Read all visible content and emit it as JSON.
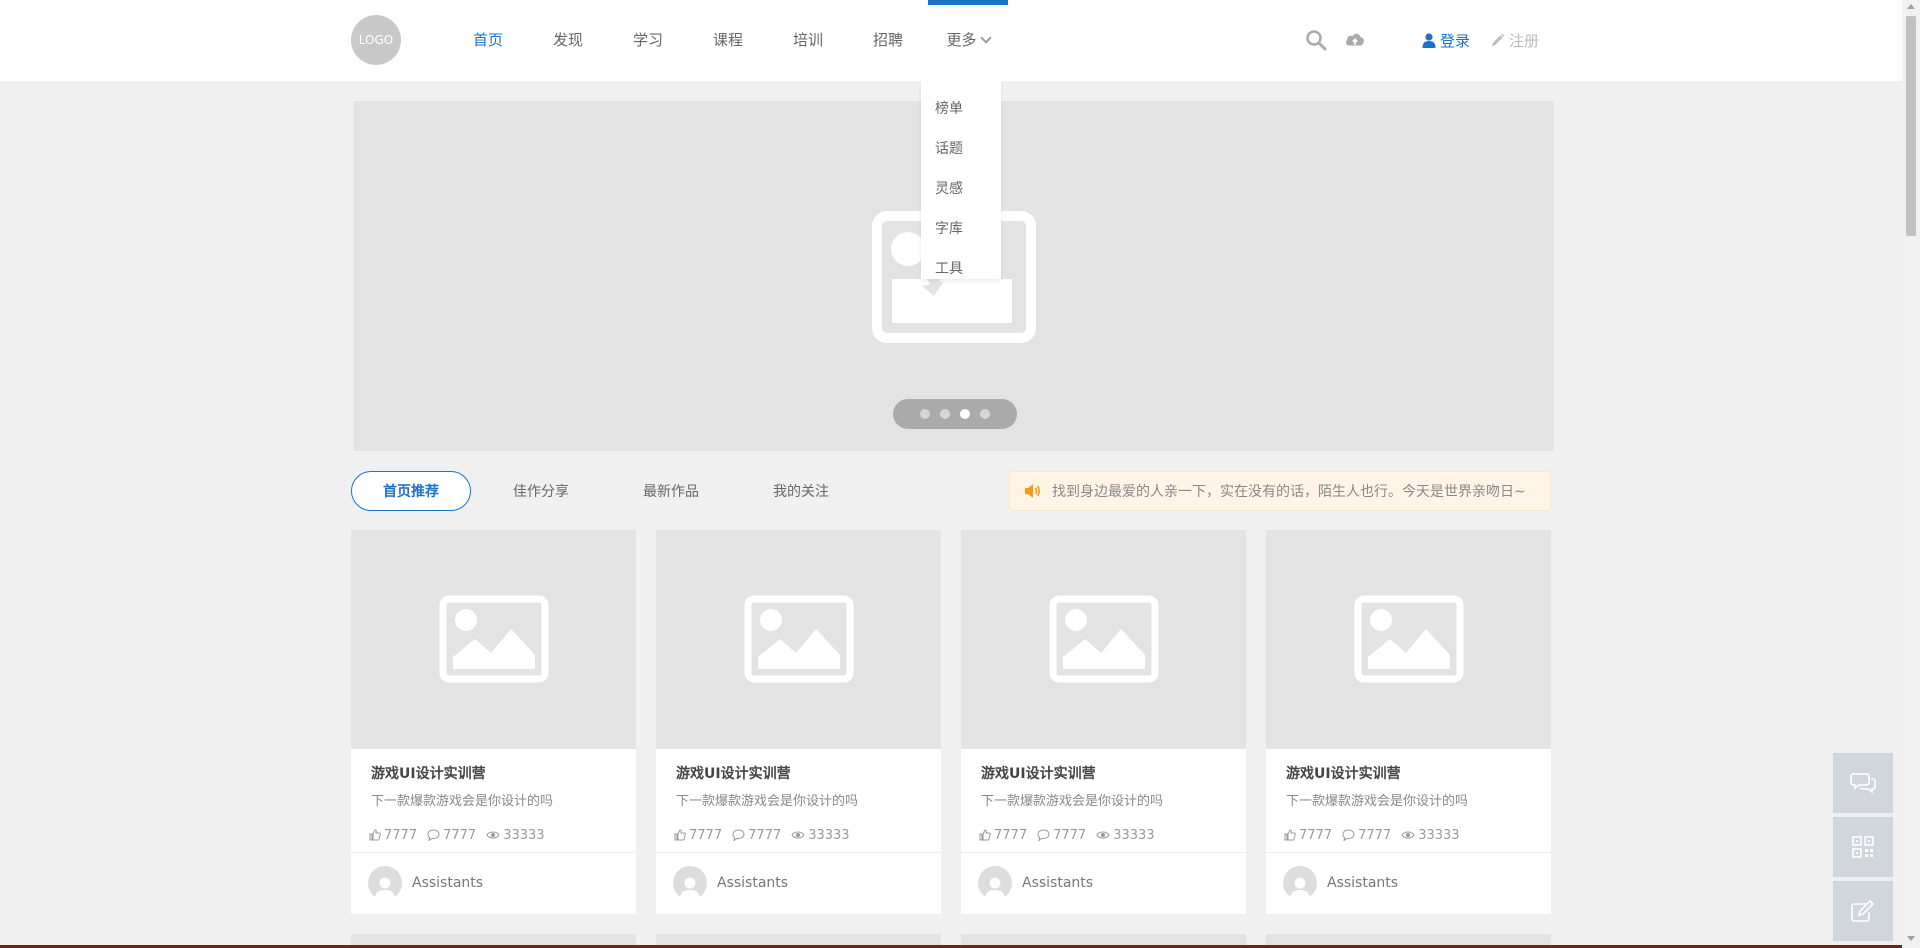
{
  "header": {
    "logo_text": "LOGO",
    "nav": [
      {
        "label": "首页",
        "active": true
      },
      {
        "label": "发现"
      },
      {
        "label": "学习"
      },
      {
        "label": "课程"
      },
      {
        "label": "培训"
      },
      {
        "label": "招聘"
      },
      {
        "label": "更多",
        "open": true
      }
    ],
    "more_menu": [
      "榜单",
      "话题",
      "灵感",
      "字库",
      "工具"
    ],
    "search_icon": "search-icon",
    "upload_icon": "cloud-upload-icon",
    "login_label": "登录",
    "register_label": "注册",
    "accent_color": "#1a73c9"
  },
  "banner": {
    "slides": 4,
    "active_slide": 3
  },
  "tabs": [
    "首页推荐",
    "佳作分享",
    "最新作品",
    "我的关注"
  ],
  "active_tab": 0,
  "notice": {
    "icon": "speaker-icon",
    "text": "找到身边最爱的人亲一下，实在没有的话，陌生人也行。今天是世界亲吻日~"
  },
  "cards": [
    {
      "title": "游戏UI设计实训营",
      "desc": "下一款爆款游戏会是你设计的吗",
      "likes": "7777",
      "comments": "7777",
      "views": "33333",
      "author": "Assistants"
    },
    {
      "title": "游戏UI设计实训营",
      "desc": "下一款爆款游戏会是你设计的吗",
      "likes": "7777",
      "comments": "7777",
      "views": "33333",
      "author": "Assistants"
    },
    {
      "title": "游戏UI设计实训营",
      "desc": "下一款爆款游戏会是你设计的吗",
      "likes": "7777",
      "comments": "7777",
      "views": "33333",
      "author": "Assistants"
    },
    {
      "title": "游戏UI设计实训营",
      "desc": "下一款爆款游戏会是你设计的吗",
      "likes": "7777",
      "comments": "7777",
      "views": "33333",
      "author": "Assistants"
    }
  ],
  "side_tools": [
    "chat-icon",
    "qrcode-icon",
    "edit-icon"
  ]
}
